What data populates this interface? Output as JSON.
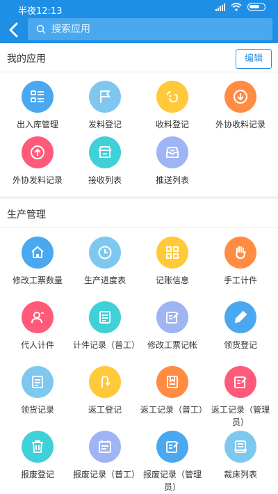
{
  "status_bar": {
    "time": "半夜12:13"
  },
  "header": {
    "search_placeholder": "搜索应用"
  },
  "my_apps": {
    "title": "我的应用",
    "edit_label": "编辑",
    "items": [
      {
        "label": "出入库管理",
        "icon": "list-icon",
        "color": "#4aa8f0"
      },
      {
        "label": "发料登记",
        "icon": "flag-icon",
        "color": "#7ec8f0"
      },
      {
        "label": "收料登记",
        "icon": "receive-icon",
        "color": "#ffc93a"
      },
      {
        "label": "外协收料记录",
        "icon": "download-icon",
        "color": "#ff8c42"
      },
      {
        "label": "外协发料记录",
        "icon": "upload-icon",
        "color": "#ff5a7a"
      },
      {
        "label": "接收列表",
        "icon": "store-icon",
        "color": "#3fd0d8"
      },
      {
        "label": "推送列表",
        "icon": "inbox-icon",
        "color": "#9fb4f3"
      }
    ]
  },
  "production": {
    "title": "生产管理",
    "items": [
      {
        "label": "修改工票数量",
        "icon": "home-icon",
        "color": "#4aa8f0"
      },
      {
        "label": "生产进度表",
        "icon": "clock-icon",
        "color": "#7ec8f0"
      },
      {
        "label": "记账信息",
        "icon": "grid-icon",
        "color": "#ffc93a"
      },
      {
        "label": "手工计件",
        "icon": "hand-icon",
        "color": "#ff8c42"
      },
      {
        "label": "代人计件",
        "icon": "person-icon",
        "color": "#ff5a7a"
      },
      {
        "label": "计件记录（普工）",
        "icon": "doc-icon",
        "color": "#3fd0d8"
      },
      {
        "label": "修改工票记帐",
        "icon": "edit-doc-icon",
        "color": "#9fb4f3"
      },
      {
        "label": "领货登记",
        "icon": "pencil-icon",
        "color": "#4aa8f0"
      },
      {
        "label": "领货记录",
        "icon": "doc-icon",
        "color": "#7ec8f0"
      },
      {
        "label": "返工登记",
        "icon": "return-icon",
        "color": "#ffc93a"
      },
      {
        "label": "返工记录（普工）",
        "icon": "bookmark-doc-icon",
        "color": "#ff8c42"
      },
      {
        "label": "返工记录（管理员）",
        "icon": "edit-doc-icon",
        "color": "#ff5a7a"
      },
      {
        "label": "报废登记",
        "icon": "trash-icon",
        "color": "#3fd0d8"
      },
      {
        "label": "报废记录（普工）",
        "icon": "calendar-icon",
        "color": "#9fb4f3"
      },
      {
        "label": "报废记录（管理员）",
        "icon": "edit-doc-icon",
        "color": "#4aa8f0"
      },
      {
        "label": "裁床列表",
        "icon": "book-icon",
        "color": "#7ec8f0"
      }
    ]
  }
}
